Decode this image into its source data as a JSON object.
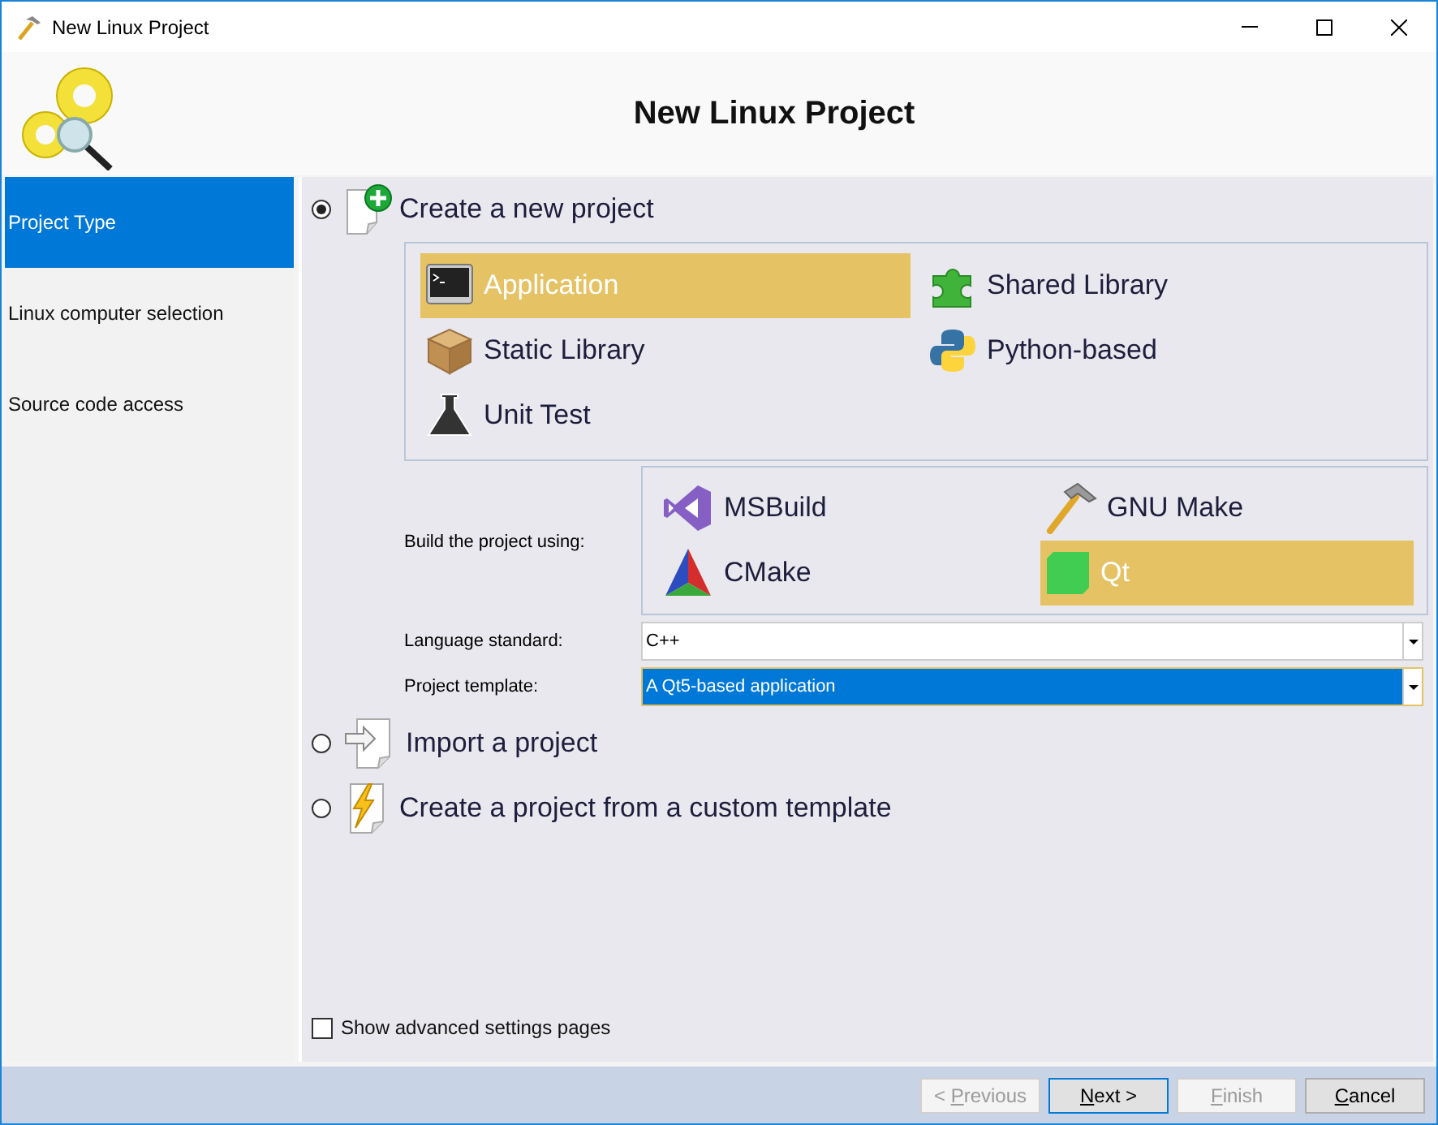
{
  "window": {
    "title": "New Linux Project"
  },
  "header": {
    "title": "New Linux Project"
  },
  "sidebar": {
    "items": [
      {
        "label": "Project Type",
        "selected": true
      },
      {
        "label": "Linux computer selection",
        "selected": false
      },
      {
        "label": "Source code access",
        "selected": false
      }
    ]
  },
  "options": [
    {
      "label": "Create a new project",
      "selected": true
    },
    {
      "label": "Import a project",
      "selected": false
    },
    {
      "label": "Create a project from a custom template",
      "selected": false
    }
  ],
  "project_types": [
    {
      "label": "Application",
      "selected": true
    },
    {
      "label": "Shared Library",
      "selected": false
    },
    {
      "label": "Static Library",
      "selected": false
    },
    {
      "label": "Python-based",
      "selected": false
    },
    {
      "label": "Unit Test",
      "selected": false
    }
  ],
  "build_label": "Build the project using:",
  "build_systems": [
    {
      "label": "MSBuild",
      "selected": false
    },
    {
      "label": "GNU Make",
      "selected": false
    },
    {
      "label": "CMake",
      "selected": false
    },
    {
      "label": "Qt",
      "selected": true
    }
  ],
  "fields": [
    {
      "label": "Language standard:",
      "value": "C++",
      "focused": false
    },
    {
      "label": "Project template:",
      "value": "A Qt5-based application",
      "focused": true
    }
  ],
  "advanced": {
    "label": "Show advanced settings pages",
    "checked": false
  },
  "buttons": [
    {
      "before": "< ",
      "key": "P",
      "after": "revious",
      "disabled": true,
      "default": false
    },
    {
      "key": "N",
      "after": "ext >",
      "disabled": false,
      "default": true
    },
    {
      "key": "F",
      "after": "inish",
      "disabled": true,
      "default": false
    },
    {
      "key": "C",
      "after": "ancel",
      "disabled": false,
      "default": false
    }
  ]
}
